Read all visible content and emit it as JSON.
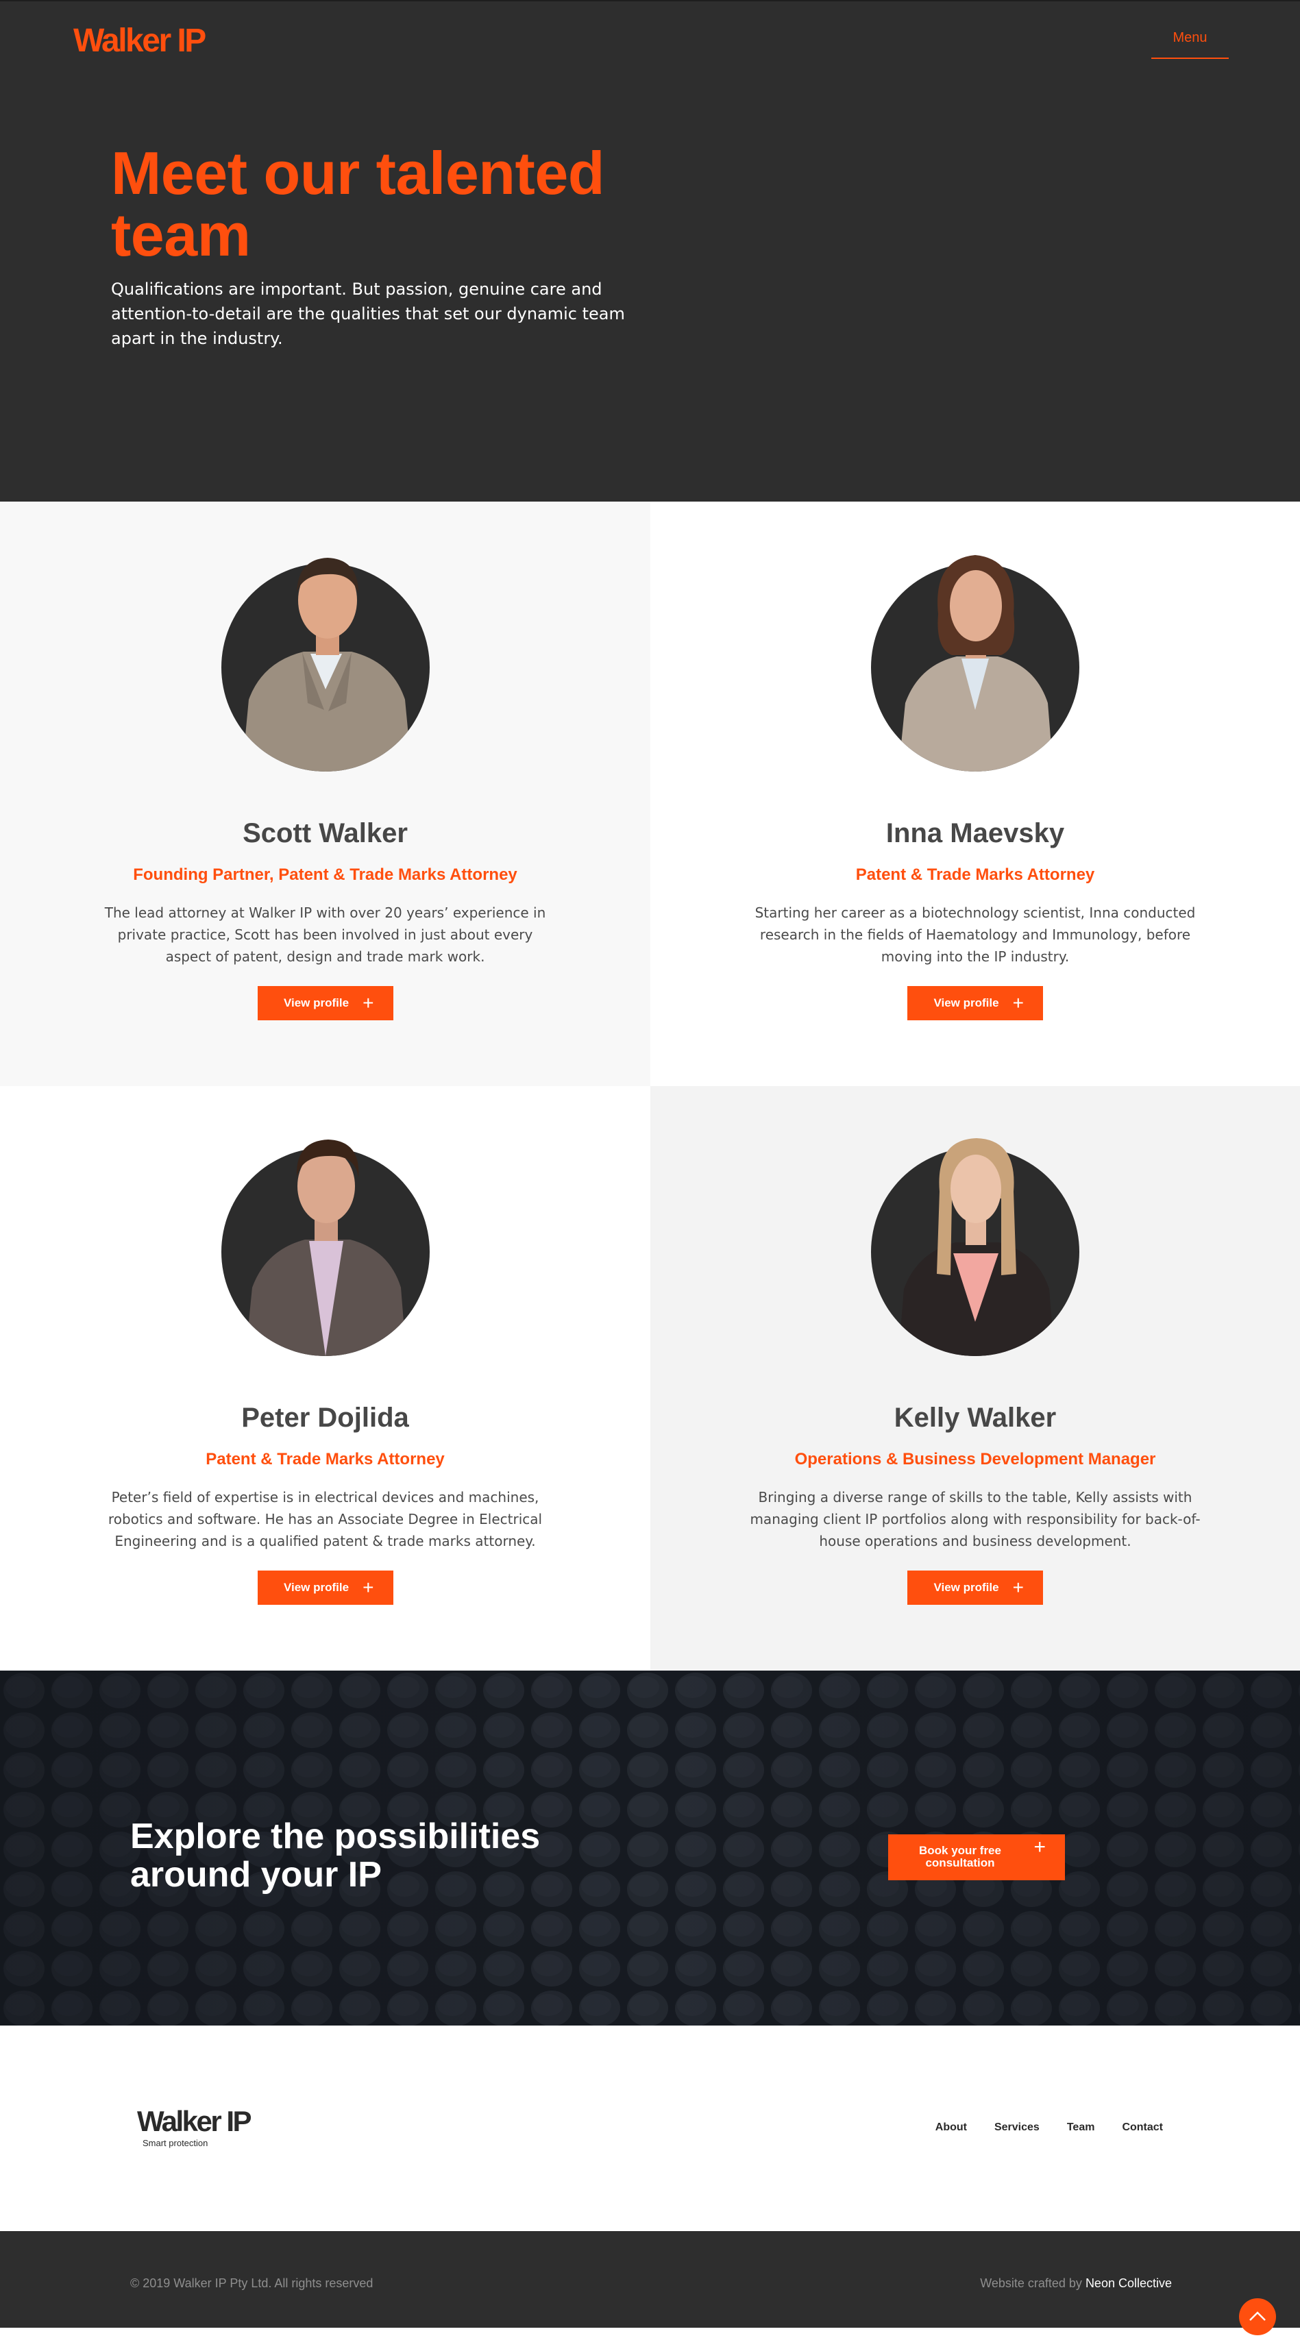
{
  "header": {
    "logo": "Walker IP",
    "menu_label": "Menu"
  },
  "hero": {
    "title": "Meet our talented team",
    "text": "Qualifications are important. But passion, genuine care and attention-to-detail are the qualities that set our dynamic team apart in the industry."
  },
  "team": [
    {
      "name": "Scott Walker",
      "role": "Founding Partner, Patent & Trade Marks Attorney",
      "bio": "The lead attorney at Walker IP with over 20 years’ experience in private practice, Scott has been involved in just about every aspect of patent, design and trade mark work.",
      "button": "View profile"
    },
    {
      "name": "Inna Maevsky",
      "role": "Patent & Trade Marks Attorney",
      "bio": "Starting her career as a biotechnology scientist, Inna conducted research in the fields of Haematology and Immunology, before moving into the IP industry.",
      "button": "View profile"
    },
    {
      "name": "Peter Dojlida",
      "role": "Patent & Trade Marks Attorney",
      "bio": "Peter’s field of expertise is in electrical devices and machines, robotics and software. He has an Associate Degree in Electrical Engineering and is a qualified patent & trade marks attorney.",
      "button": "View profile"
    },
    {
      "name": "Kelly Walker",
      "role": "Operations & Business Development Manager",
      "bio": "Bringing a diverse range of skills to the table, Kelly assists with managing client IP portfolios along with responsibility for back-of-house operations and business development.",
      "button": "View profile"
    }
  ],
  "cta": {
    "title": "Explore the possibilities around your IP",
    "button": "Book your free consultation"
  },
  "footer": {
    "logo": "Walker IP",
    "tagline": "Smart protection",
    "nav": [
      "About",
      "Services",
      "Team",
      "Contact"
    ],
    "copyright": "© 2019 Walker IP Pty Ltd. All rights reserved",
    "crafted_prefix": "Website crafted by ",
    "crafted_brand": "Neon Collective"
  },
  "colors": {
    "accent": "#ff4f0e",
    "dark": "#2e2e2e",
    "text": "#474747"
  },
  "icons": {
    "plus": "plus-icon",
    "back_to_top": "chevron-up-icon"
  }
}
